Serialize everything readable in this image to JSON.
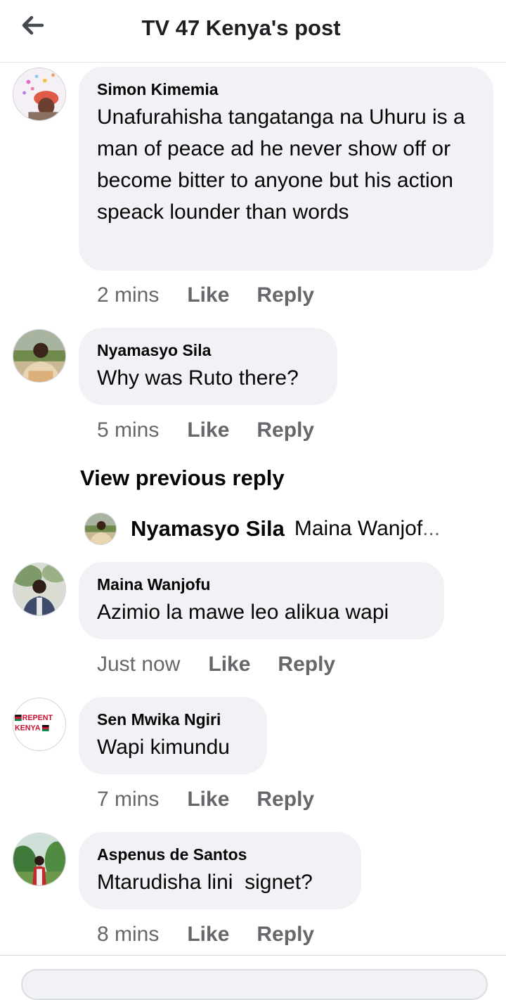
{
  "header": {
    "title": "TV 47 Kenya's post"
  },
  "comments": [
    {
      "name": "Simon Kimemia",
      "text": "Unafurahisha tangatanga na Uhuru is a man of peace ad he never show off or become bitter to anyone but his action speack lounder than words",
      "time": "2 mins",
      "like": "Like",
      "reply": "Reply"
    },
    {
      "name": "Nyamasyo Sila",
      "text": "Why was Ruto there?",
      "time": "5 mins",
      "like": "Like",
      "reply": "Reply"
    },
    {
      "name": "Maina Wanjofu",
      "text": "Azimio la mawe leo alikua wapi",
      "time": "Just now",
      "like": "Like",
      "reply": "Reply"
    },
    {
      "name": "Sen Mwika Ngiri",
      "text": "Wapi kimundu",
      "time": "7 mins",
      "like": "Like",
      "reply": "Reply"
    },
    {
      "name": "Aspenus de Santos",
      "text": "Mtarudisha lini  signet?",
      "time": "8 mins",
      "like": "Like",
      "reply": "Reply"
    }
  ],
  "view_previous": "View previous reply",
  "reply_preview": {
    "name": "Nyamasyo Sila",
    "text": "Maina Wanjof",
    "ellipsis": "..."
  },
  "avatar_badge": {
    "line1": "REPENT",
    "line2": "KENYA"
  },
  "icons": {
    "back": "back-arrow-icon"
  },
  "colors": {
    "bubble": "#f0f2f5",
    "meta": "#65676b",
    "text": "#050505"
  }
}
